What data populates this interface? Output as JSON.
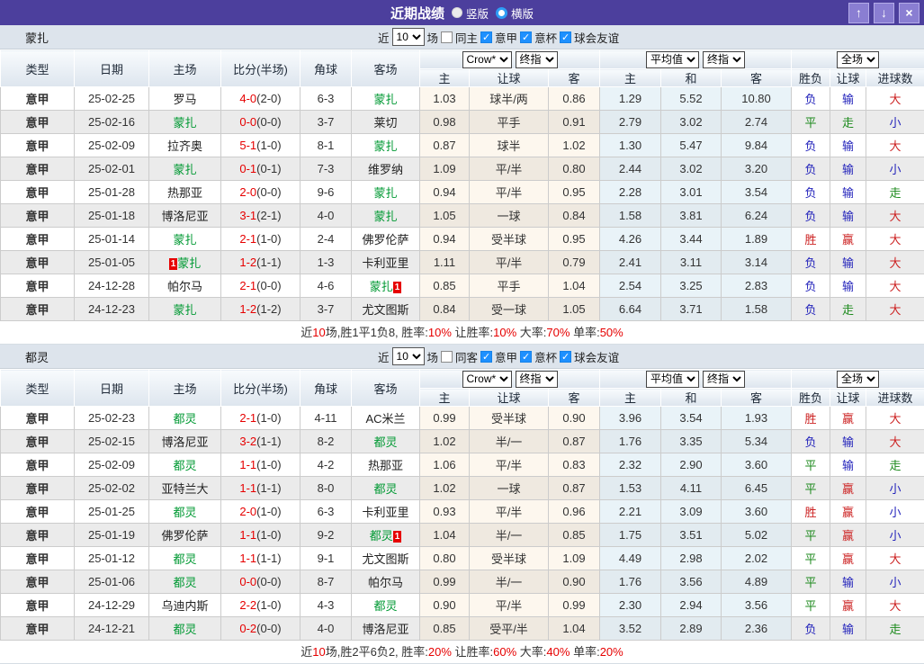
{
  "titlebar": {
    "title": "近期战绩",
    "layout_options": [
      {
        "label": "竖版",
        "selected": true
      },
      {
        "label": "横版",
        "selected": false
      }
    ],
    "window_buttons": {
      "up": "↑",
      "down": "↓",
      "close": "×"
    }
  },
  "colors": {
    "titlebar_bg": "#4c3f9d",
    "league_cell_bg": "#1e9fff",
    "team_highlight": "#009933",
    "score_red": "#e60000",
    "win_red": "#cc2222",
    "draw_green": "#1d8a1d",
    "lose_blue": "#2323bb"
  },
  "result_colors": {
    "胜": "#cc2222",
    "赢": "#cc2222",
    "大": "#cc2222",
    "平": "#1d8a1d",
    "走": "#1d8a1d",
    "负": "#2323bb",
    "输": "#2323bb",
    "小": "#2323bb"
  },
  "filter_labels": {
    "near": "近",
    "count": "10",
    "games": "场"
  },
  "header": {
    "left_columns": [
      "类型",
      "日期",
      "主场",
      "比分(半场)",
      "角球",
      "客场"
    ],
    "odds_dropdowns": [
      "Crow*",
      "终指"
    ],
    "avg_dropdowns": [
      "平均值",
      "终指"
    ],
    "scope_dropdown": "全场",
    "sub_columns": [
      "主",
      "让球",
      "客",
      "主",
      "和",
      "客",
      "胜负",
      "让球",
      "进球数"
    ]
  },
  "sections": [
    {
      "team": "蒙扎",
      "same_filter": {
        "label": "同主",
        "checked": false
      },
      "league_filters": [
        {
          "label": "意甲",
          "checked": true
        },
        {
          "label": "意杯",
          "checked": true
        },
        {
          "label": "球会友谊",
          "checked": true
        }
      ],
      "rows": [
        {
          "league": "意甲",
          "date": "25-02-25",
          "home": {
            "name": "罗马",
            "green": false
          },
          "score": "4-0",
          "half": "(2-0)",
          "corner": "6-3",
          "away": {
            "name": "蒙扎",
            "green": true
          },
          "odds": [
            "1.03",
            "球半/两",
            "0.86"
          ],
          "avg": [
            "1.29",
            "5.52",
            "10.80"
          ],
          "results": [
            "负",
            "输",
            "大"
          ]
        },
        {
          "league": "意甲",
          "date": "25-02-16",
          "home": {
            "name": "蒙扎",
            "green": true
          },
          "score": "0-0",
          "half": "(0-0)",
          "corner": "3-7",
          "away": {
            "name": "莱切",
            "green": false
          },
          "odds": [
            "0.98",
            "平手",
            "0.91"
          ],
          "avg": [
            "2.79",
            "3.02",
            "2.74"
          ],
          "results": [
            "平",
            "走",
            "小"
          ]
        },
        {
          "league": "意甲",
          "date": "25-02-09",
          "home": {
            "name": "拉齐奥",
            "green": false
          },
          "score": "5-1",
          "half": "(1-0)",
          "corner": "8-1",
          "away": {
            "name": "蒙扎",
            "green": true
          },
          "odds": [
            "0.87",
            "球半",
            "1.02"
          ],
          "avg": [
            "1.30",
            "5.47",
            "9.84"
          ],
          "results": [
            "负",
            "输",
            "大"
          ]
        },
        {
          "league": "意甲",
          "date": "25-02-01",
          "home": {
            "name": "蒙扎",
            "green": true
          },
          "score": "0-1",
          "half": "(0-1)",
          "corner": "7-3",
          "away": {
            "name": "维罗纳",
            "green": false
          },
          "odds": [
            "1.09",
            "平/半",
            "0.80"
          ],
          "avg": [
            "2.44",
            "3.02",
            "3.20"
          ],
          "results": [
            "负",
            "输",
            "小"
          ]
        },
        {
          "league": "意甲",
          "date": "25-01-28",
          "home": {
            "name": "热那亚",
            "green": false
          },
          "score": "2-0",
          "half": "(0-0)",
          "corner": "9-6",
          "away": {
            "name": "蒙扎",
            "green": true
          },
          "odds": [
            "0.94",
            "平/半",
            "0.95"
          ],
          "avg": [
            "2.28",
            "3.01",
            "3.54"
          ],
          "results": [
            "负",
            "输",
            "走"
          ]
        },
        {
          "league": "意甲",
          "date": "25-01-18",
          "home": {
            "name": "博洛尼亚",
            "green": false
          },
          "score": "3-1",
          "half": "(2-1)",
          "corner": "4-0",
          "away": {
            "name": "蒙扎",
            "green": true
          },
          "odds": [
            "1.05",
            "一球",
            "0.84"
          ],
          "avg": [
            "1.58",
            "3.81",
            "6.24"
          ],
          "results": [
            "负",
            "输",
            "大"
          ]
        },
        {
          "league": "意甲",
          "date": "25-01-14",
          "home": {
            "name": "蒙扎",
            "green": true
          },
          "score": "2-1",
          "half": "(1-0)",
          "corner": "2-4",
          "away": {
            "name": "佛罗伦萨",
            "green": false
          },
          "odds": [
            "0.94",
            "受半球",
            "0.95"
          ],
          "avg": [
            "4.26",
            "3.44",
            "1.89"
          ],
          "results": [
            "胜",
            "赢",
            "大"
          ]
        },
        {
          "league": "意甲",
          "date": "25-01-05",
          "home": {
            "name": "蒙扎",
            "green": true,
            "badge_before": "1"
          },
          "score": "1-2",
          "half": "(1-1)",
          "corner": "1-3",
          "away": {
            "name": "卡利亚里",
            "green": false
          },
          "odds": [
            "1.11",
            "平/半",
            "0.79"
          ],
          "avg": [
            "2.41",
            "3.11",
            "3.14"
          ],
          "results": [
            "负",
            "输",
            "大"
          ]
        },
        {
          "league": "意甲",
          "date": "24-12-28",
          "home": {
            "name": "帕尔马",
            "green": false
          },
          "score": "2-1",
          "half": "(0-0)",
          "corner": "4-6",
          "away": {
            "name": "蒙扎",
            "green": true,
            "badge_after": "1"
          },
          "odds": [
            "0.85",
            "平手",
            "1.04"
          ],
          "avg": [
            "2.54",
            "3.25",
            "2.83"
          ],
          "results": [
            "负",
            "输",
            "大"
          ]
        },
        {
          "league": "意甲",
          "date": "24-12-23",
          "home": {
            "name": "蒙扎",
            "green": true
          },
          "score": "1-2",
          "half": "(1-2)",
          "corner": "3-7",
          "away": {
            "name": "尤文图斯",
            "green": false
          },
          "odds": [
            "0.84",
            "受一球",
            "1.05"
          ],
          "avg": [
            "6.64",
            "3.71",
            "1.58"
          ],
          "results": [
            "负",
            "走",
            "大"
          ]
        }
      ],
      "summary": [
        {
          "text": "近"
        },
        {
          "text": "10",
          "red": true
        },
        {
          "text": "场,胜1平1负8, 胜率:"
        },
        {
          "text": "10%",
          "red": true
        },
        {
          "text": " 让胜率:"
        },
        {
          "text": "10%",
          "red": true
        },
        {
          "text": " 大率:"
        },
        {
          "text": "70%",
          "red": true
        },
        {
          "text": " 单率:"
        },
        {
          "text": "50%",
          "red": true
        }
      ]
    },
    {
      "team": "都灵",
      "same_filter": {
        "label": "同客",
        "checked": false
      },
      "league_filters": [
        {
          "label": "意甲",
          "checked": true
        },
        {
          "label": "意杯",
          "checked": true
        },
        {
          "label": "球会友谊",
          "checked": true
        }
      ],
      "rows": [
        {
          "league": "意甲",
          "date": "25-02-23",
          "home": {
            "name": "都灵",
            "green": true
          },
          "score": "2-1",
          "half": "(1-0)",
          "corner": "4-11",
          "away": {
            "name": "AC米兰",
            "green": false
          },
          "odds": [
            "0.99",
            "受半球",
            "0.90"
          ],
          "avg": [
            "3.96",
            "3.54",
            "1.93"
          ],
          "results": [
            "胜",
            "赢",
            "大"
          ]
        },
        {
          "league": "意甲",
          "date": "25-02-15",
          "home": {
            "name": "博洛尼亚",
            "green": false
          },
          "score": "3-2",
          "half": "(1-1)",
          "corner": "8-2",
          "away": {
            "name": "都灵",
            "green": true
          },
          "odds": [
            "1.02",
            "半/一",
            "0.87"
          ],
          "avg": [
            "1.76",
            "3.35",
            "5.34"
          ],
          "results": [
            "负",
            "输",
            "大"
          ]
        },
        {
          "league": "意甲",
          "date": "25-02-09",
          "home": {
            "name": "都灵",
            "green": true
          },
          "score": "1-1",
          "half": "(1-0)",
          "corner": "4-2",
          "away": {
            "name": "热那亚",
            "green": false
          },
          "odds": [
            "1.06",
            "平/半",
            "0.83"
          ],
          "avg": [
            "2.32",
            "2.90",
            "3.60"
          ],
          "results": [
            "平",
            "输",
            "走"
          ]
        },
        {
          "league": "意甲",
          "date": "25-02-02",
          "home": {
            "name": "亚特兰大",
            "green": false
          },
          "score": "1-1",
          "half": "(1-1)",
          "corner": "8-0",
          "away": {
            "name": "都灵",
            "green": true
          },
          "odds": [
            "1.02",
            "一球",
            "0.87"
          ],
          "avg": [
            "1.53",
            "4.11",
            "6.45"
          ],
          "results": [
            "平",
            "赢",
            "小"
          ]
        },
        {
          "league": "意甲",
          "date": "25-01-25",
          "home": {
            "name": "都灵",
            "green": true
          },
          "score": "2-0",
          "half": "(1-0)",
          "corner": "6-3",
          "away": {
            "name": "卡利亚里",
            "green": false
          },
          "odds": [
            "0.93",
            "平/半",
            "0.96"
          ],
          "avg": [
            "2.21",
            "3.09",
            "3.60"
          ],
          "results": [
            "胜",
            "赢",
            "小"
          ]
        },
        {
          "league": "意甲",
          "date": "25-01-19",
          "home": {
            "name": "佛罗伦萨",
            "green": false
          },
          "score": "1-1",
          "half": "(1-0)",
          "corner": "9-2",
          "away": {
            "name": "都灵",
            "green": true,
            "badge_after": "1"
          },
          "odds": [
            "1.04",
            "半/一",
            "0.85"
          ],
          "avg": [
            "1.75",
            "3.51",
            "5.02"
          ],
          "results": [
            "平",
            "赢",
            "小"
          ]
        },
        {
          "league": "意甲",
          "date": "25-01-12",
          "home": {
            "name": "都灵",
            "green": true
          },
          "score": "1-1",
          "half": "(1-1)",
          "corner": "9-1",
          "away": {
            "name": "尤文图斯",
            "green": false
          },
          "odds": [
            "0.80",
            "受半球",
            "1.09"
          ],
          "avg": [
            "4.49",
            "2.98",
            "2.02"
          ],
          "results": [
            "平",
            "赢",
            "大"
          ]
        },
        {
          "league": "意甲",
          "date": "25-01-06",
          "home": {
            "name": "都灵",
            "green": true
          },
          "score": "0-0",
          "half": "(0-0)",
          "corner": "8-7",
          "away": {
            "name": "帕尔马",
            "green": false
          },
          "odds": [
            "0.99",
            "半/一",
            "0.90"
          ],
          "avg": [
            "1.76",
            "3.56",
            "4.89"
          ],
          "results": [
            "平",
            "输",
            "小"
          ]
        },
        {
          "league": "意甲",
          "date": "24-12-29",
          "home": {
            "name": "乌迪内斯",
            "green": false
          },
          "score": "2-2",
          "half": "(1-0)",
          "corner": "4-3",
          "away": {
            "name": "都灵",
            "green": true
          },
          "odds": [
            "0.90",
            "平/半",
            "0.99"
          ],
          "avg": [
            "2.30",
            "2.94",
            "3.56"
          ],
          "results": [
            "平",
            "赢",
            "大"
          ]
        },
        {
          "league": "意甲",
          "date": "24-12-21",
          "home": {
            "name": "都灵",
            "green": true
          },
          "score": "0-2",
          "half": "(0-0)",
          "corner": "4-0",
          "away": {
            "name": "博洛尼亚",
            "green": false
          },
          "odds": [
            "0.85",
            "受平/半",
            "1.04"
          ],
          "avg": [
            "3.52",
            "2.89",
            "2.36"
          ],
          "results": [
            "负",
            "输",
            "走"
          ]
        }
      ],
      "summary": [
        {
          "text": "近"
        },
        {
          "text": "10",
          "red": true
        },
        {
          "text": "场,胜2平6负2, 胜率:"
        },
        {
          "text": "20%",
          "red": true
        },
        {
          "text": " 让胜率:"
        },
        {
          "text": "60%",
          "red": true
        },
        {
          "text": " 大率:"
        },
        {
          "text": "40%",
          "red": true
        },
        {
          "text": " 单率:"
        },
        {
          "text": "20%",
          "red": true
        }
      ]
    }
  ]
}
